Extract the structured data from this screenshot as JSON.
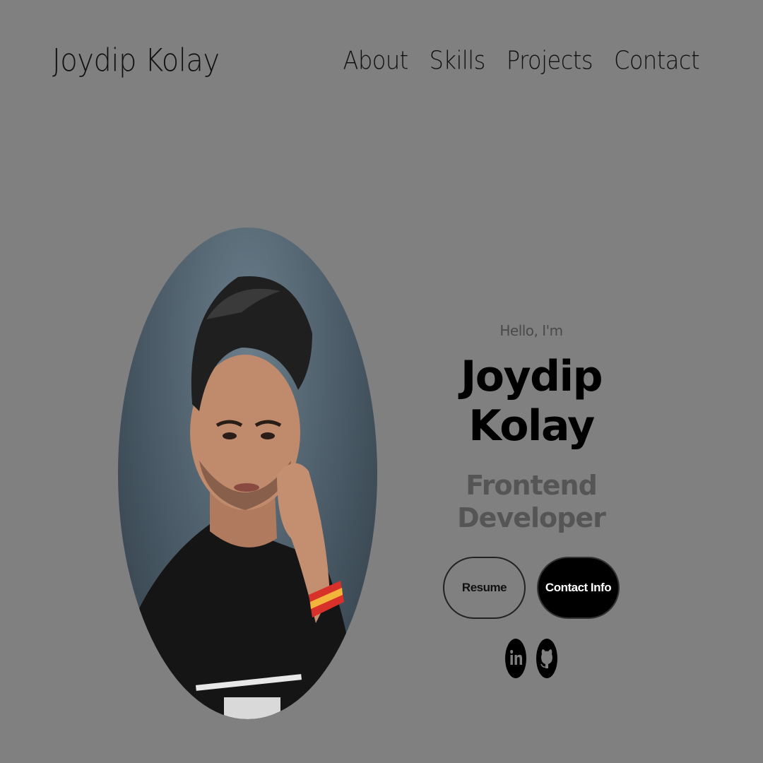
{
  "nav": {
    "logo": "Joydip Kolay",
    "links": [
      {
        "label": "About"
      },
      {
        "label": "Skills"
      },
      {
        "label": "Projects"
      },
      {
        "label": "Contact"
      }
    ]
  },
  "hero": {
    "greeting": "Hello, I'm",
    "name": "Joydip Kolay",
    "title": "Frontend Developer",
    "buttons": {
      "resume_label": "Resume",
      "contact_label": "Contact Info"
    },
    "social": [
      {
        "icon": "linkedin-icon"
      },
      {
        "icon": "github-icon"
      }
    ]
  },
  "colors": {
    "background": "#808080",
    "text": "#111111",
    "accent_button": "#000000"
  }
}
